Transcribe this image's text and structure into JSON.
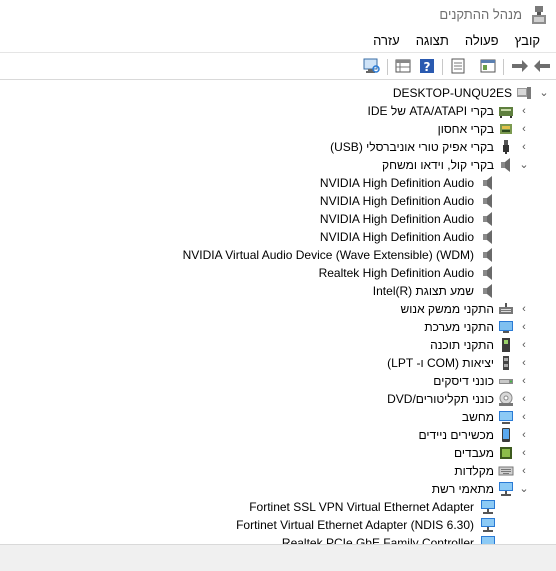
{
  "window": {
    "title": "מנהל ההתקנים"
  },
  "menu": {
    "items": [
      "קובץ",
      "פעולה",
      "תצוגה",
      "עזרה"
    ]
  },
  "toolbar": {
    "buttons": [
      "back-arrow-icon",
      "forward-arrow-icon",
      "properties-icon",
      "update-driver-icon",
      "help-icon",
      "view-grid-icon",
      "scan-hardware-icon"
    ]
  },
  "tree": {
    "root": "DESKTOP-UNQU2ES",
    "categories": [
      {
        "label": "בקרי ATA/ATAPI של IDE",
        "icon": "ide-controller-icon",
        "expanded": false
      },
      {
        "label": "בקרי אחסון",
        "icon": "storage-controller-icon",
        "expanded": false
      },
      {
        "label": "בקרי אפיק טורי אוניברסלי (USB)",
        "icon": "usb-icon",
        "expanded": false
      },
      {
        "label": "בקרי קול, וידאו ומשחק",
        "icon": "speaker-icon",
        "expanded": true,
        "children": [
          "NVIDIA High Definition Audio",
          "NVIDIA High Definition Audio",
          "NVIDIA High Definition Audio",
          "NVIDIA High Definition Audio",
          "NVIDIA Virtual Audio Device (Wave Extensible) (WDM)",
          "Realtek High Definition Audio",
          "שמע תצוגת Intel(R)"
        ]
      },
      {
        "label": "התקני ממשק אנוש",
        "icon": "hid-icon",
        "expanded": false
      },
      {
        "label": "התקני מערכת",
        "icon": "system-devices-icon",
        "expanded": false
      },
      {
        "label": "התקני תוכנה",
        "icon": "software-device-icon",
        "expanded": false
      },
      {
        "label": "יציאות (COM ו- LPT)",
        "icon": "port-icon",
        "expanded": false
      },
      {
        "label": "כונני דיסקים",
        "icon": "disk-drive-icon",
        "expanded": false
      },
      {
        "label": "כונני תקליטורים/DVD",
        "icon": "dvd-drive-icon",
        "expanded": false
      },
      {
        "label": "מחשב",
        "icon": "computer-icon",
        "expanded": false
      },
      {
        "label": "מכשירים ניידים",
        "icon": "portable-device-icon",
        "expanded": false
      },
      {
        "label": "מעבדים",
        "icon": "processor-icon",
        "expanded": false
      },
      {
        "label": "מקלדות",
        "icon": "keyboard-icon",
        "expanded": false
      },
      {
        "label": "מתאמי רשת",
        "icon": "network-adapter-icon",
        "expanded": true,
        "children": [
          "Fortinet SSL VPN Virtual Ethernet Adapter",
          "Fortinet Virtual Ethernet Adapter (NDIS 6.30)",
          "Realtek PCIe GbE Family Controller"
        ]
      }
    ]
  }
}
